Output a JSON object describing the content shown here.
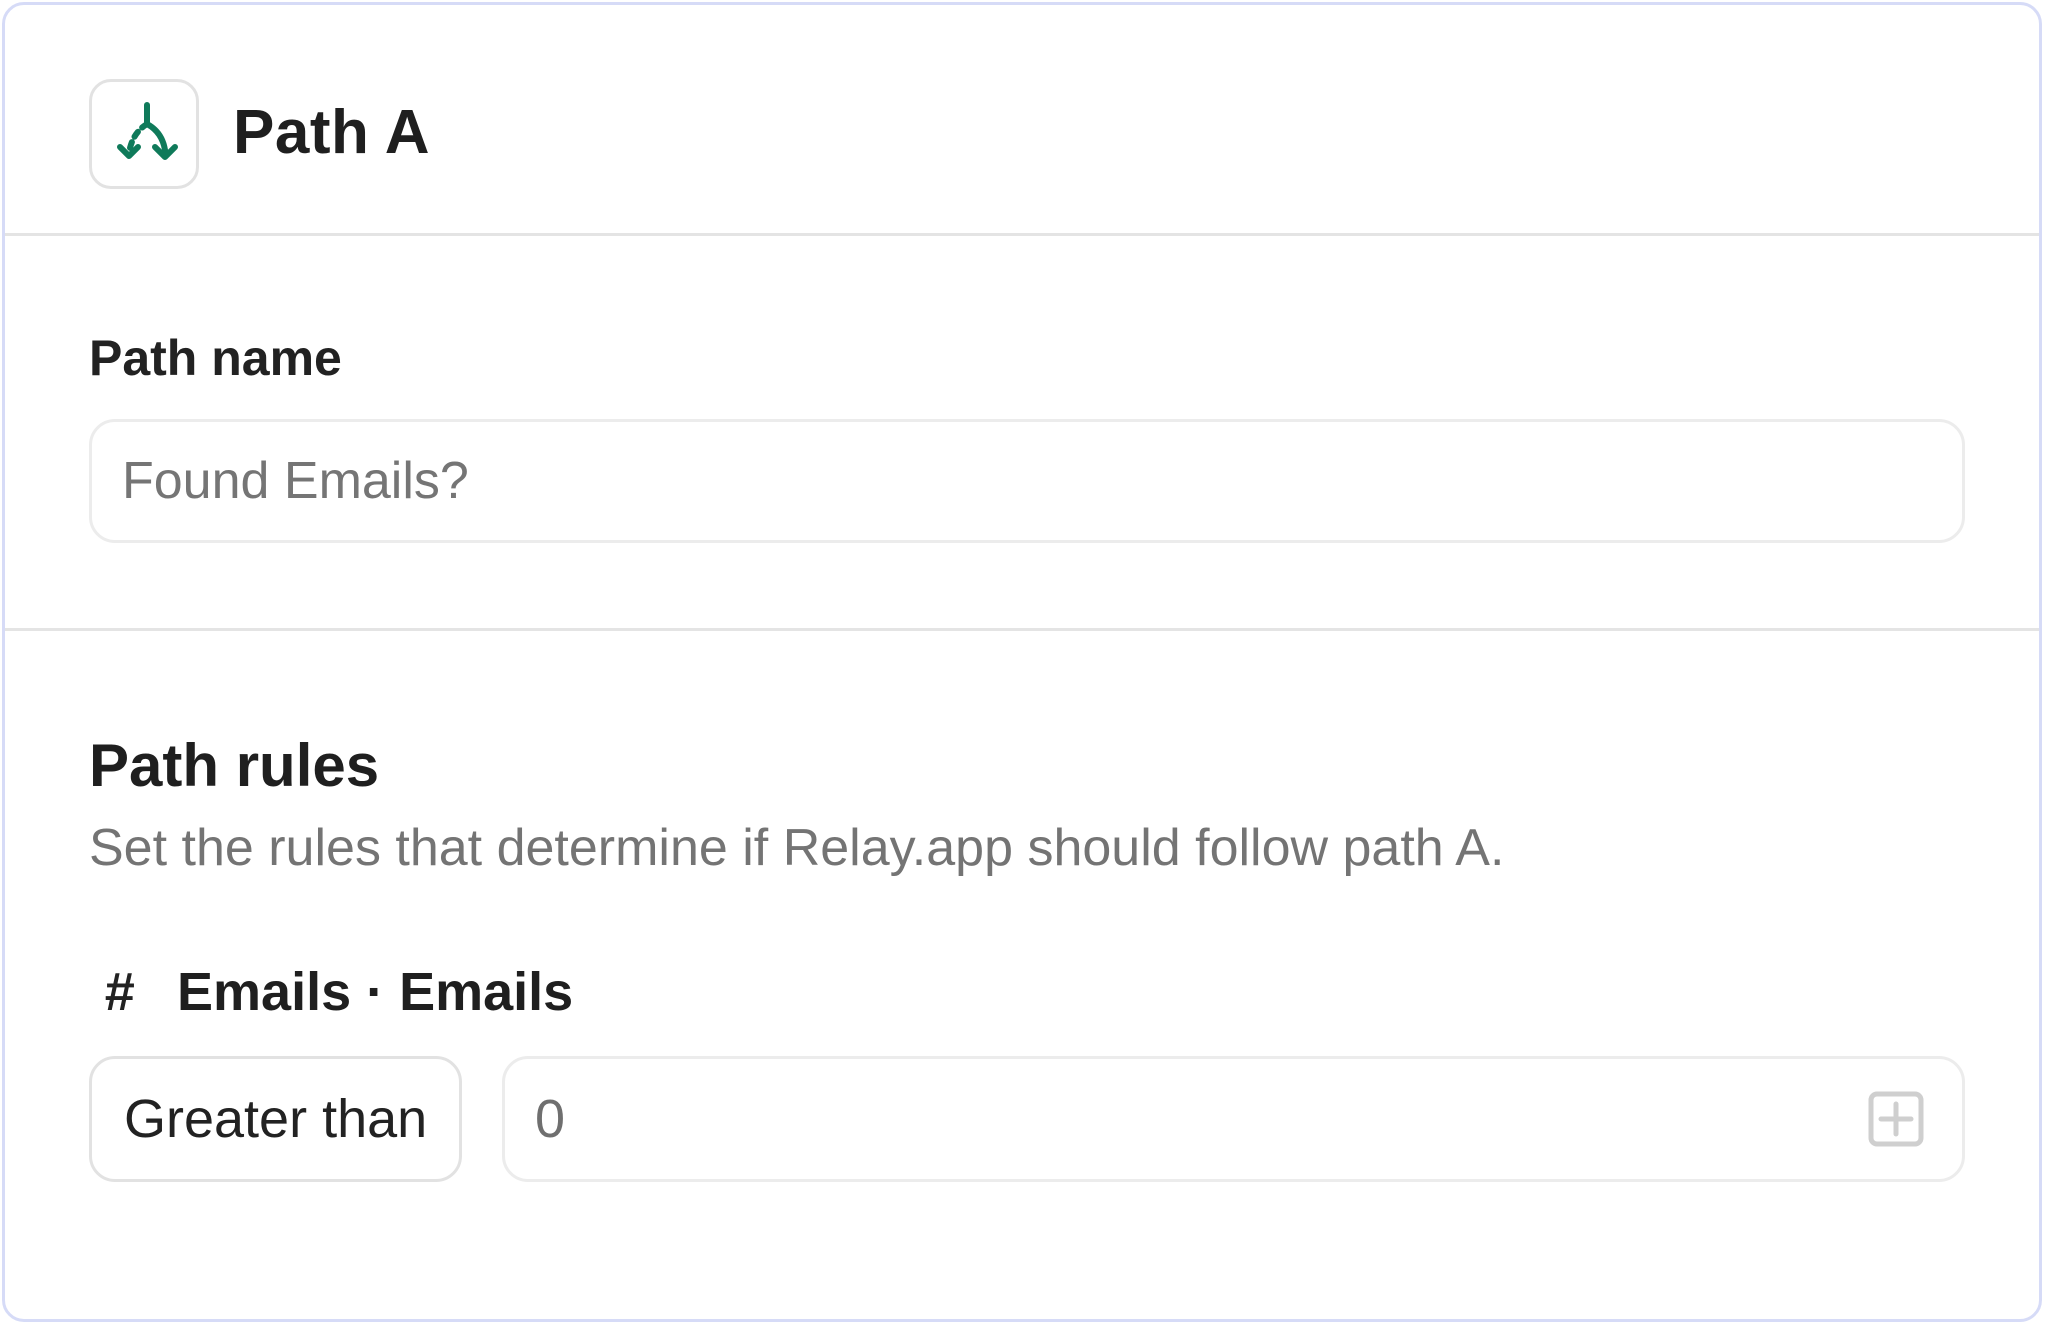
{
  "header": {
    "icon": "branch-split-icon",
    "title": "Path A"
  },
  "path_name": {
    "label": "Path name",
    "placeholder": "Found Emails?",
    "value": ""
  },
  "rules": {
    "title": "Path rules",
    "description": "Set the rules that determine if Relay.app should follow path A.",
    "field": {
      "type_icon": "#",
      "label": "Emails · Emails"
    },
    "operator": "Greater than",
    "value": "0",
    "add_icon": "add-square-icon"
  },
  "colors": {
    "accent": "#0f7a5a",
    "panel_border": "#d6dbf7",
    "divider": "#e4e4e4",
    "muted_text": "#747474"
  }
}
